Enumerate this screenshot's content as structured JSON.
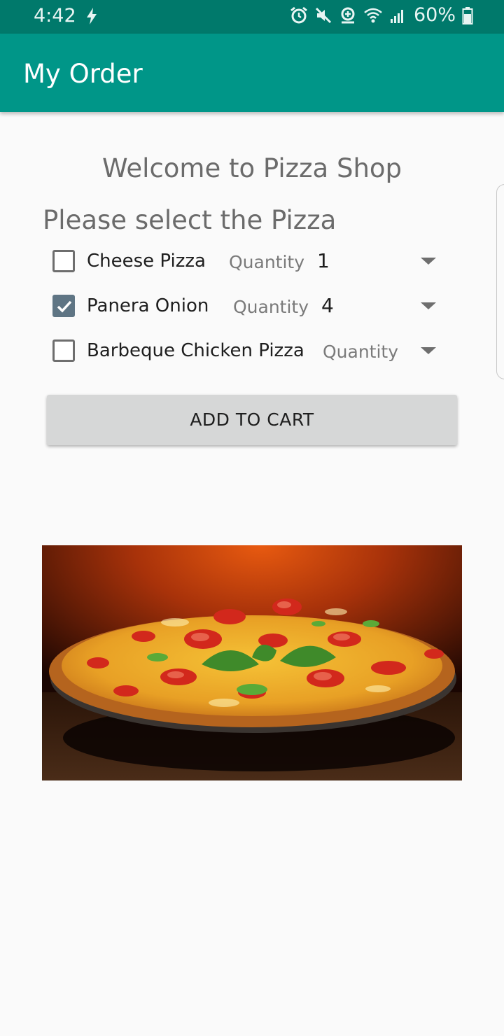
{
  "status_bar": {
    "time": "4:42",
    "battery": "60%",
    "icons": [
      "charging-bolt-icon",
      "alarm-icon",
      "mute-icon",
      "data-saver-icon",
      "wifi-icon",
      "signal-icon",
      "battery-icon"
    ]
  },
  "app_bar": {
    "title": "My Order",
    "color": "#009688"
  },
  "main": {
    "welcome": "Welcome to Pizza Shop",
    "select_title": "Please select the Pizza",
    "items": [
      {
        "label": "Cheese Pizza",
        "checked": false,
        "qty_label": "Quantity",
        "qty_value": "1"
      },
      {
        "label": "Panera Onion",
        "checked": true,
        "qty_label": "Quantity",
        "qty_value": "4"
      },
      {
        "label": "Barbeque Chicken Pizza",
        "checked": false,
        "qty_label": "Quantity",
        "qty_value": ""
      }
    ],
    "add_to_cart": "ADD TO CART",
    "image": "pizza-photo"
  }
}
